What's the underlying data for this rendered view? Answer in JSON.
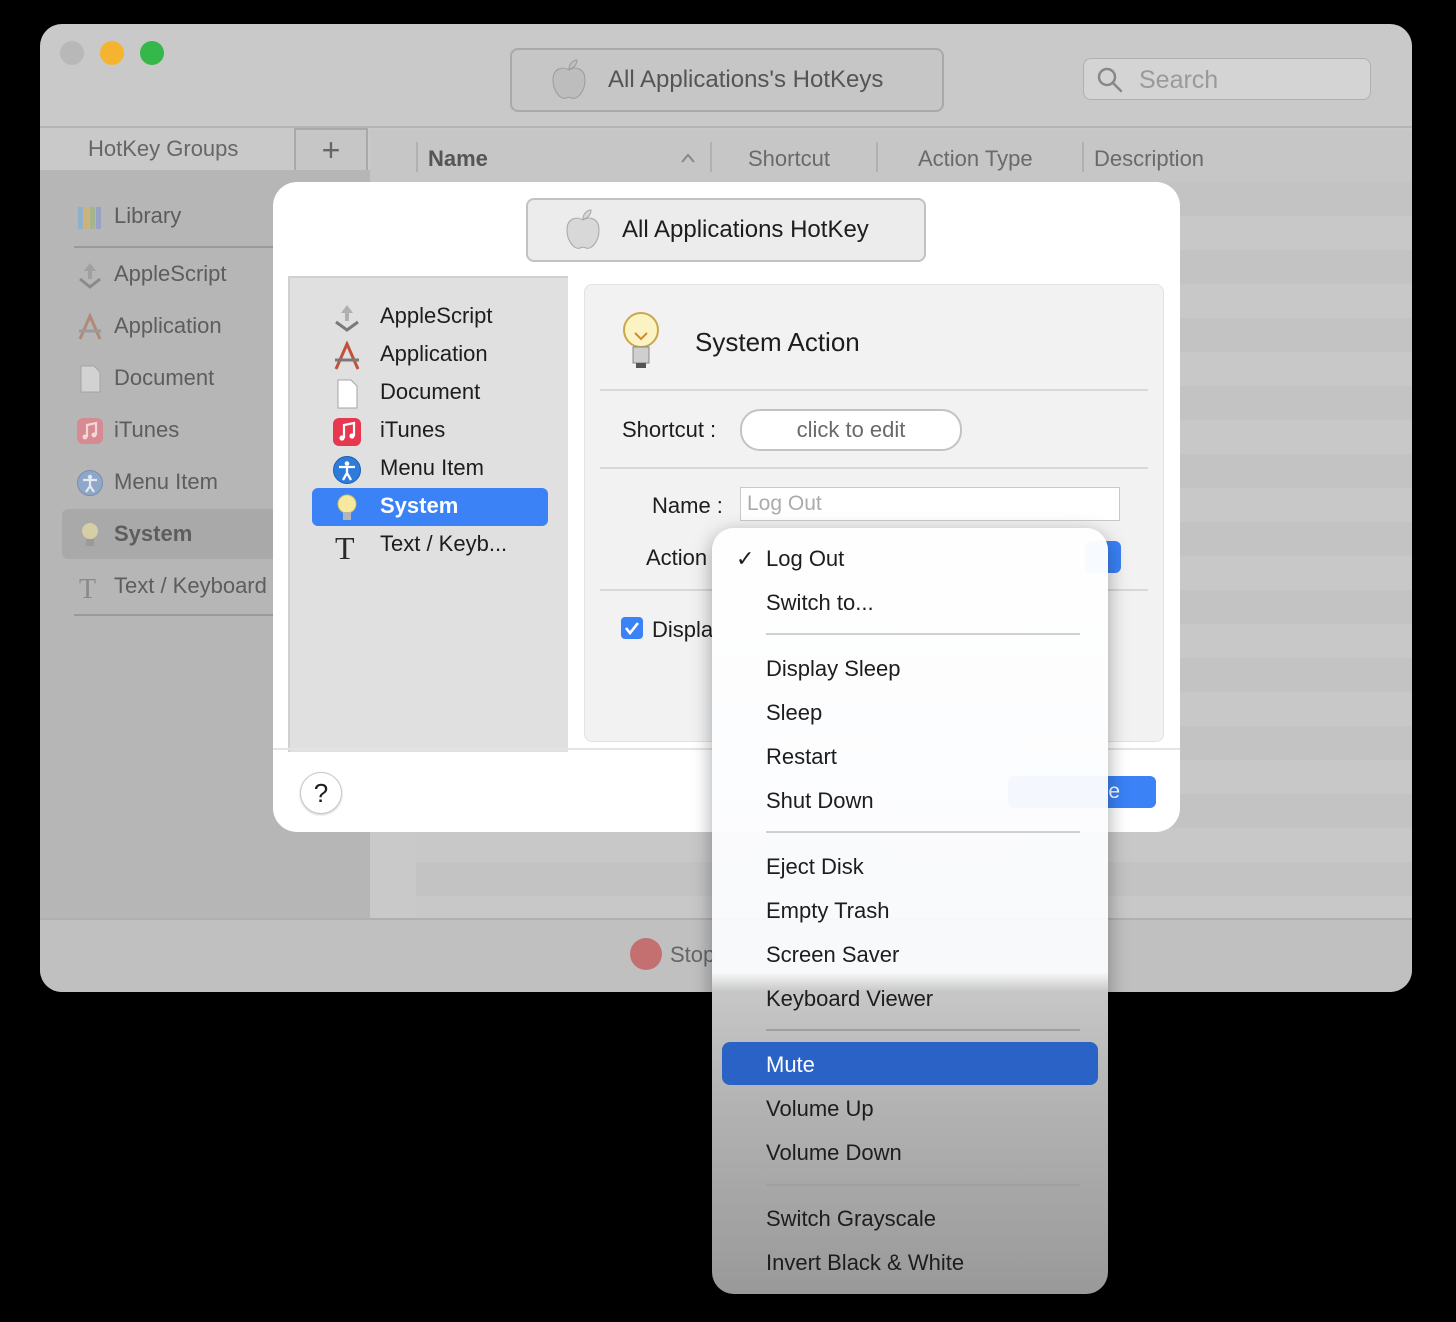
{
  "window": {
    "title_button": "All Applications's HotKeys",
    "search_placeholder": "Search",
    "groups_label": "HotKey Groups",
    "add_label": "+",
    "sidebar": [
      {
        "label": "Library",
        "icon": "library-icon"
      },
      {
        "label": "AppleScript",
        "icon": "applescript-icon"
      },
      {
        "label": "Application",
        "icon": "application-icon"
      },
      {
        "label": "Document",
        "icon": "document-icon"
      },
      {
        "label": "iTunes",
        "icon": "itunes-icon"
      },
      {
        "label": "Menu Item",
        "icon": "accessibility-icon"
      },
      {
        "label": "System",
        "icon": "lightbulb-icon",
        "selected": true
      },
      {
        "label": "Text / Keyboard",
        "icon": "text-icon"
      }
    ],
    "columns": [
      "Name",
      "Shortcut",
      "Action Type",
      "Description"
    ],
    "stop_label": "Stop"
  },
  "sheet": {
    "title_button": "All Applications HotKey",
    "types": [
      {
        "label": "AppleScript",
        "icon": "applescript-icon"
      },
      {
        "label": "Application",
        "icon": "application-icon"
      },
      {
        "label": "Document",
        "icon": "document-icon"
      },
      {
        "label": "iTunes",
        "icon": "itunes-icon"
      },
      {
        "label": "Menu Item",
        "icon": "accessibility-icon"
      },
      {
        "label": "System",
        "icon": "lightbulb-icon",
        "selected": true
      },
      {
        "label": "Text / Keyb...",
        "icon": "text-icon"
      }
    ],
    "detail": {
      "heading": "System Action",
      "shortcut_label": "Shortcut :",
      "shortcut_button": "click to edit",
      "name_label": "Name :",
      "name_placeholder": "Log Out",
      "action_label": "Action",
      "display_label": "Displa",
      "display_checked": true
    },
    "help_label": "?",
    "save_label": "e"
  },
  "menu": {
    "checkmark": "✓",
    "items": [
      "Log Out",
      "Switch to...",
      "Display Sleep",
      "Sleep",
      "Restart",
      "Shut Down",
      "Eject Disk",
      "Empty Trash",
      "Screen Saver",
      "Keyboard Viewer",
      "Mute",
      "Volume Up",
      "Volume Down",
      "Switch Grayscale",
      "Invert Black & White"
    ],
    "checked": "Log Out",
    "highlighted": "Mute"
  },
  "colors": {
    "accent": "#3a82f6",
    "highlight": "#2a63c5",
    "close": "#b8b8b8",
    "minimize": "#f5b430",
    "zoom": "#34b84a"
  }
}
